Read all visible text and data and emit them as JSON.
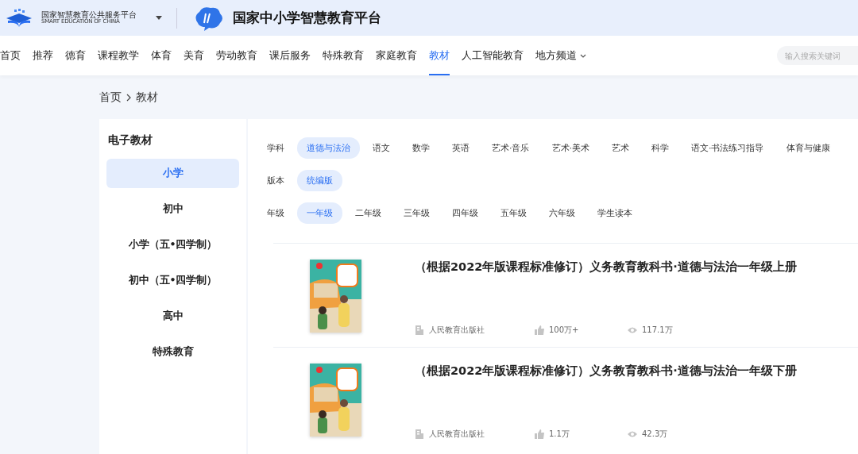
{
  "header": {
    "org_name": "国家智慧教育公共服务平台",
    "org_name_en": "SMART EDUCATION OF CHINA",
    "platform_name": "国家中小学智慧教育平台"
  },
  "nav": {
    "items": [
      {
        "label": "首页",
        "selected": false
      },
      {
        "label": "推荐",
        "selected": false
      },
      {
        "label": "德育",
        "selected": false
      },
      {
        "label": "课程教学",
        "selected": false
      },
      {
        "label": "体育",
        "selected": false
      },
      {
        "label": "美育",
        "selected": false
      },
      {
        "label": "劳动教育",
        "selected": false
      },
      {
        "label": "课后服务",
        "selected": false
      },
      {
        "label": "特殊教育",
        "selected": false
      },
      {
        "label": "家庭教育",
        "selected": false
      },
      {
        "label": "教材",
        "selected": true
      },
      {
        "label": "人工智能教育",
        "selected": false
      },
      {
        "label": "地方频道",
        "selected": false,
        "dropdown": true
      }
    ],
    "search": {
      "placeholder": "输入搜索关键词"
    }
  },
  "breadcrumb": [
    "首页",
    "教材"
  ],
  "sidebar": {
    "title": "电子教材",
    "items": [
      {
        "label": "小学",
        "selected": true
      },
      {
        "label": "初中",
        "selected": false
      },
      {
        "label": "小学（五•四学制）",
        "selected": false
      },
      {
        "label": "初中（五•四学制）",
        "selected": false
      },
      {
        "label": "高中",
        "selected": false
      },
      {
        "label": "特殊教育",
        "selected": false
      }
    ]
  },
  "filters": [
    {
      "label": "学科",
      "options": [
        {
          "label": "道德与法治",
          "selected": true
        },
        {
          "label": "语文",
          "selected": false
        },
        {
          "label": "数学",
          "selected": false
        },
        {
          "label": "英语",
          "selected": false
        },
        {
          "label": "艺术·音乐",
          "selected": false
        },
        {
          "label": "艺术·美术",
          "selected": false
        },
        {
          "label": "艺术",
          "selected": false
        },
        {
          "label": "科学",
          "selected": false
        },
        {
          "label": "语文·书法练习指导",
          "selected": false
        },
        {
          "label": "体育与健康",
          "selected": false
        }
      ]
    },
    {
      "label": "版本",
      "options": [
        {
          "label": "统编版",
          "selected": true
        }
      ]
    },
    {
      "label": "年级",
      "options": [
        {
          "label": "一年级",
          "selected": true
        },
        {
          "label": "二年级",
          "selected": false
        },
        {
          "label": "三年级",
          "selected": false
        },
        {
          "label": "四年级",
          "selected": false
        },
        {
          "label": "五年级",
          "selected": false
        },
        {
          "label": "六年级",
          "selected": false
        },
        {
          "label": "学生读本",
          "selected": false
        }
      ]
    }
  ],
  "books": [
    {
      "title": "（根据2022年版课程标准修订）义务教育教科书·道德与法治一年级上册",
      "publisher": "人民教育出版社",
      "likes": "100万+",
      "views": "117.1万"
    },
    {
      "title": "（根据2022年版课程标准修订）义务教育教科书·道德与法治一年级下册",
      "publisher": "人民教育出版社",
      "likes": "1.1万",
      "views": "42.3万"
    }
  ]
}
